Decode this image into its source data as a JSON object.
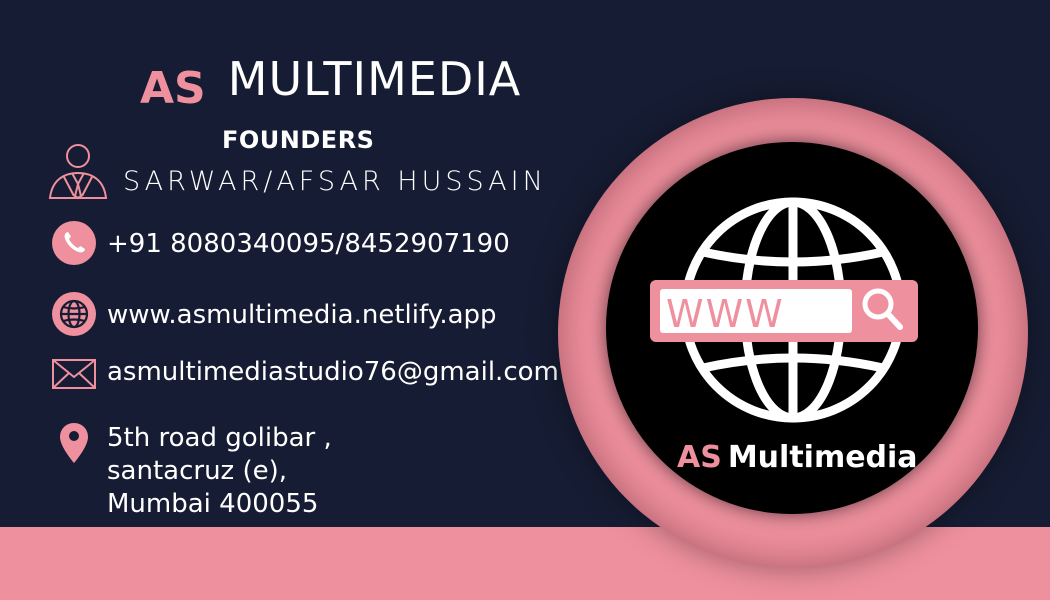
{
  "brand": {
    "prefix": "AS",
    "name": "MULTIMEDIA"
  },
  "founders": {
    "label": "FOUNDERS",
    "names": "SARWAR/AFSAR HUSSAIN"
  },
  "contact": {
    "phone": "+91 8080340095/8452907190",
    "website": "www.asmultimedia.netlify.app",
    "email": "asmultimediastudio76@gmail.com",
    "address": [
      "5th road golibar ,",
      "santacruz (e),",
      "Mumbai 400055"
    ]
  },
  "logo": {
    "search_text": "WWW",
    "prefix": "AS",
    "name": "Multimedia"
  },
  "icons": [
    "person-icon",
    "phone-icon",
    "globe-icon",
    "mail-icon",
    "location-pin-icon",
    "globe-logo-icon",
    "search-icon"
  ],
  "colors": {
    "background": "#161c33",
    "accent": "#ef909e",
    "text": "#ffffff",
    "disc": "#000000"
  }
}
